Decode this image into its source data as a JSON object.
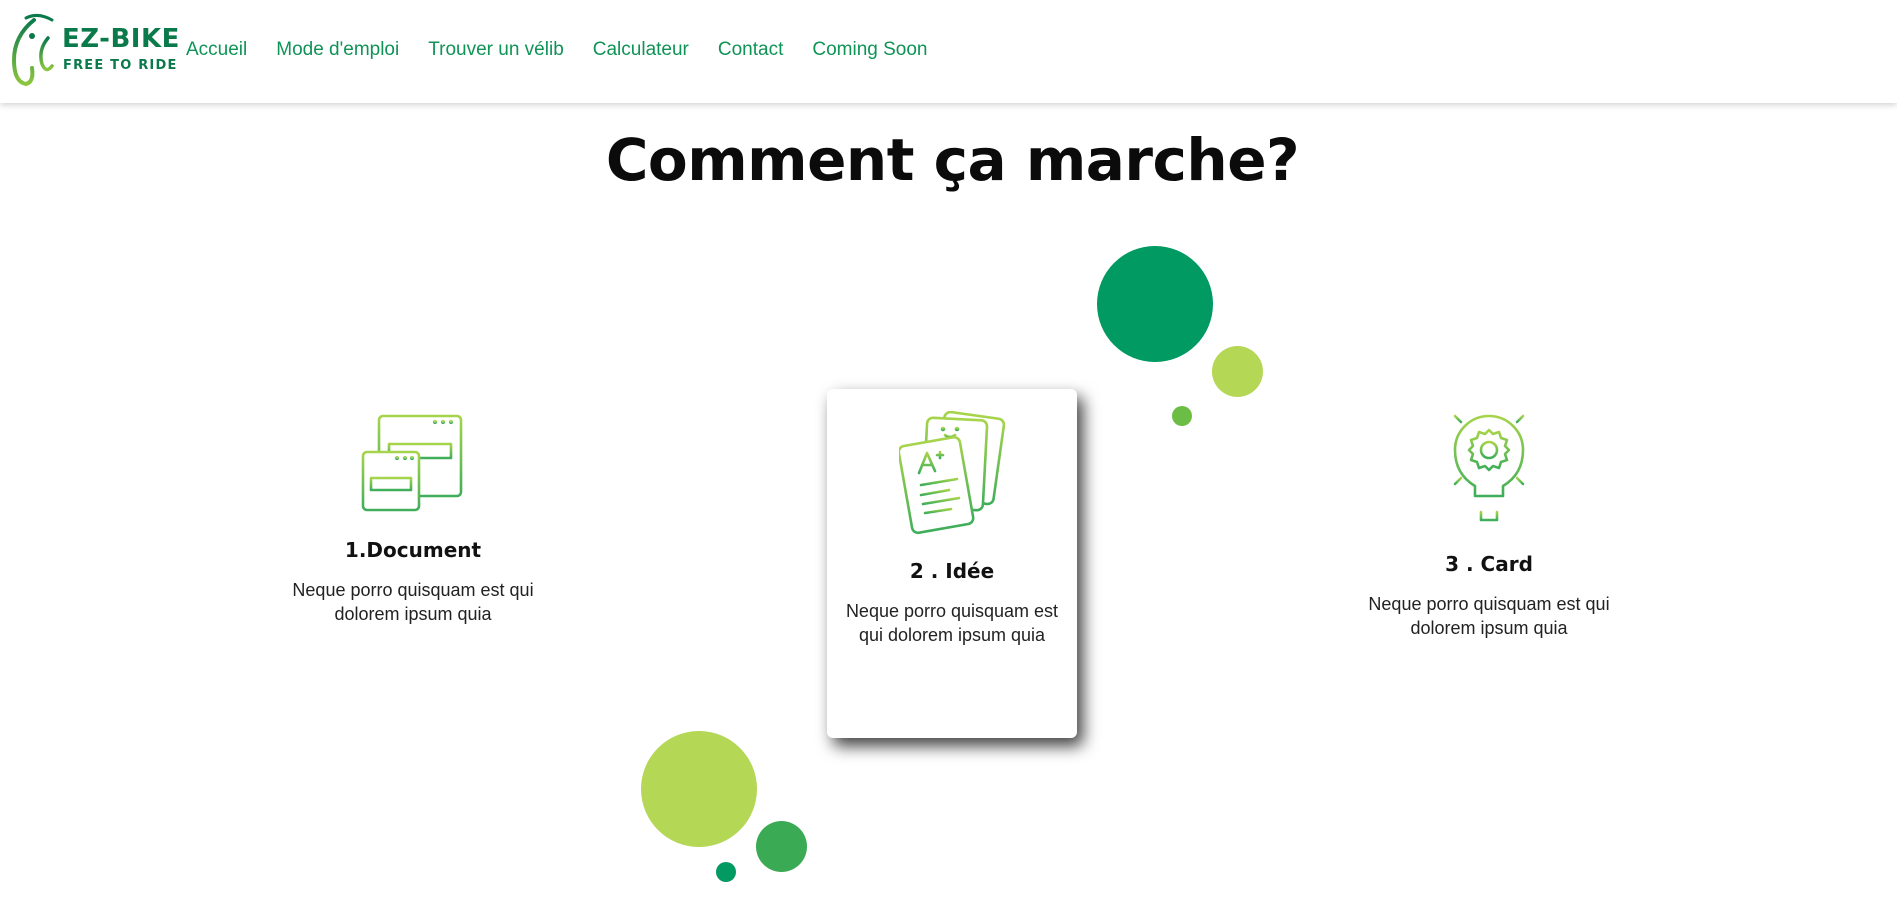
{
  "brand": {
    "name": "EZ-BIKE",
    "tagline": "FREE TO RIDE",
    "logo_icon": "bicycle-icon",
    "primary_color": "#0b7a4b",
    "accent_color": "#8cc63f"
  },
  "nav": {
    "links": [
      {
        "label": "Accueil"
      },
      {
        "label": "Mode d'emploi"
      },
      {
        "label": "Trouver un vélib"
      },
      {
        "label": "Calculateur"
      },
      {
        "label": "Contact"
      },
      {
        "label": "Coming Soon"
      }
    ]
  },
  "main": {
    "title": "Comment ça marche?",
    "features": [
      {
        "icon": "documents-icon",
        "title": "1.Document",
        "text": "Neque porro quisquam est qui dolorem ipsum quia"
      },
      {
        "icon": "graded-papers-icon",
        "title": "2 . Idée",
        "text": "Neque porro quisquam est qui dolorem ipsum quia",
        "highlighted": true
      },
      {
        "icon": "lightbulb-gear-icon",
        "title": "3 . Card",
        "text": "Neque porro quisquam est qui dolorem ipsum quia"
      }
    ]
  },
  "decor": {
    "colors": {
      "dark_green": "#009a62",
      "lime": "#b4d755",
      "mid_green": "#3aaa55",
      "light_green": "#6cbd45"
    }
  }
}
